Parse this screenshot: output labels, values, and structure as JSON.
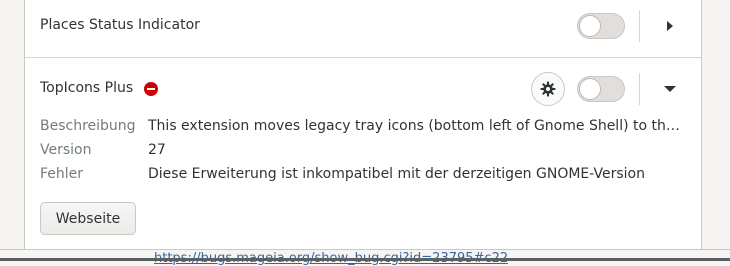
{
  "extensions": [
    {
      "name": "Places Status Indicator",
      "enabled": false,
      "expanded": false
    },
    {
      "name": "TopIcons Plus",
      "enabled": false,
      "expanded": true,
      "has_error": true,
      "details": {
        "description_label": "Beschreibung",
        "description_value": "This extension moves legacy tray icons (bottom left of Gnome Shell) to the top pa…",
        "version_label": "Version",
        "version_value": "27",
        "error_label": "Fehler",
        "error_value": "Diese Erweiterung ist inkompatibel mit der derzeitigen GNOME-Version"
      },
      "website_button": "Webseite"
    }
  ],
  "background_link": "https://bugs.mageia.org/show_bug.cgi?id=23795#c22",
  "colors": {
    "error_icon": "#cc0000",
    "link": "#3465a4",
    "label": "#727c7e"
  },
  "icons": [
    "menu-right-icon",
    "menu-down-icon",
    "error-icon",
    "gear-icon"
  ]
}
